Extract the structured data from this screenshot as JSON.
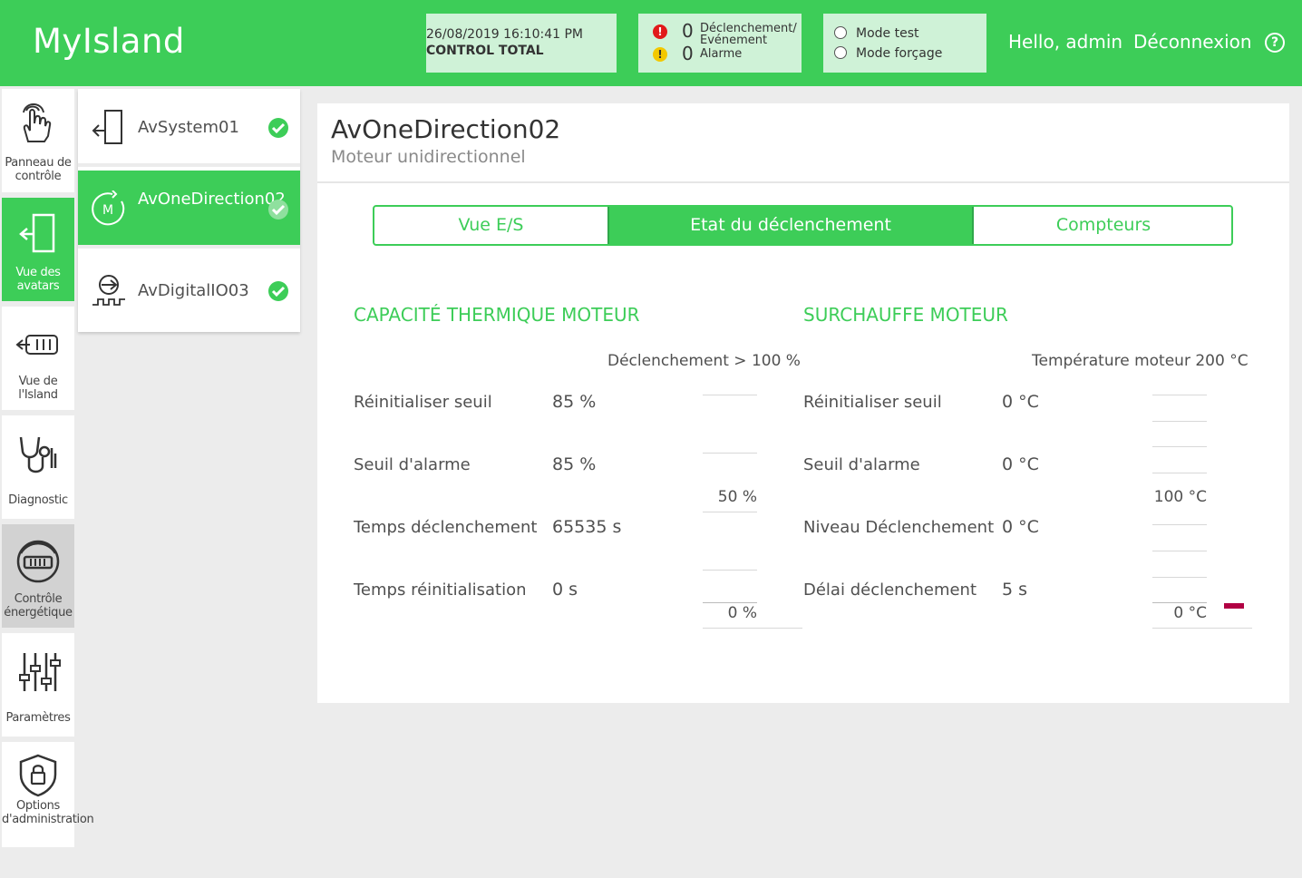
{
  "header": {
    "logo": "MyIsland",
    "datetime": "26/08/2019 16:10:41 PM",
    "control": "CONTROL TOTAL",
    "trip_count": "0",
    "trip_label": "Déclenchement/ Evénement",
    "alarm_count": "0",
    "alarm_label": "Alarme",
    "mode_test": "Mode test",
    "mode_forcing": "Mode forçage",
    "hello": "Hello, admin",
    "logout": "Déconnexion",
    "help": "?"
  },
  "nav": {
    "items": [
      {
        "label": "Panneau de contrôle",
        "icon": "hand-touch-icon"
      },
      {
        "label": "Vue des avatars",
        "icon": "avatar-enter-icon"
      },
      {
        "label": "Vue de l'Island",
        "icon": "island-view-icon"
      },
      {
        "label": "Diagnostic",
        "icon": "stethoscope-icon"
      },
      {
        "label": "Contrôle énergétique",
        "icon": "energy-meter-icon"
      },
      {
        "label": "Paramètres",
        "icon": "sliders-icon"
      },
      {
        "label": "Options d'administration",
        "icon": "shield-lock-icon"
      }
    ]
  },
  "avatars": [
    {
      "name": "AvSystem01",
      "icon": "system-enter-icon"
    },
    {
      "name": "AvOneDirection02",
      "icon": "motor-icon"
    },
    {
      "name": "AvDigitalIO03",
      "icon": "digital-io-icon"
    }
  ],
  "panel": {
    "title": "AvOneDirection02",
    "subtitle": "Moteur unidirectionnel",
    "tabs": [
      "Vue E/S",
      "Etat du déclenchement",
      "Compteurs"
    ],
    "thermal": {
      "title": "CAPACITÉ THERMIQUE MOTEUR",
      "trip_header": "Déclenchement > 100 %",
      "rows": [
        {
          "label": "Réinitialiser seuil",
          "value": "85 %"
        },
        {
          "label": "Seuil d'alarme",
          "value": "85 %"
        },
        {
          "label": "Temps déclenchement",
          "value": "65535 s"
        },
        {
          "label": "Temps réinitialisation",
          "value": "0 s"
        }
      ],
      "scale_mid": "50 %",
      "scale_low": "0 %"
    },
    "overheat": {
      "title": "SURCHAUFFE MOTEUR",
      "trip_header": "Température moteur 200 °C",
      "rows": [
        {
          "label": "Réinitialiser seuil",
          "value": "0 °C"
        },
        {
          "label": "Seuil d'alarme",
          "value": "0 °C"
        },
        {
          "label": "Niveau Déclenchement",
          "value": "0 °C"
        },
        {
          "label": "Délai déclenchement",
          "value": "5 s"
        }
      ],
      "scale_mid": "100 °C",
      "scale_low": "0 °C"
    }
  },
  "colors": {
    "accent": "#3dcd58",
    "marker": "#b10043"
  }
}
